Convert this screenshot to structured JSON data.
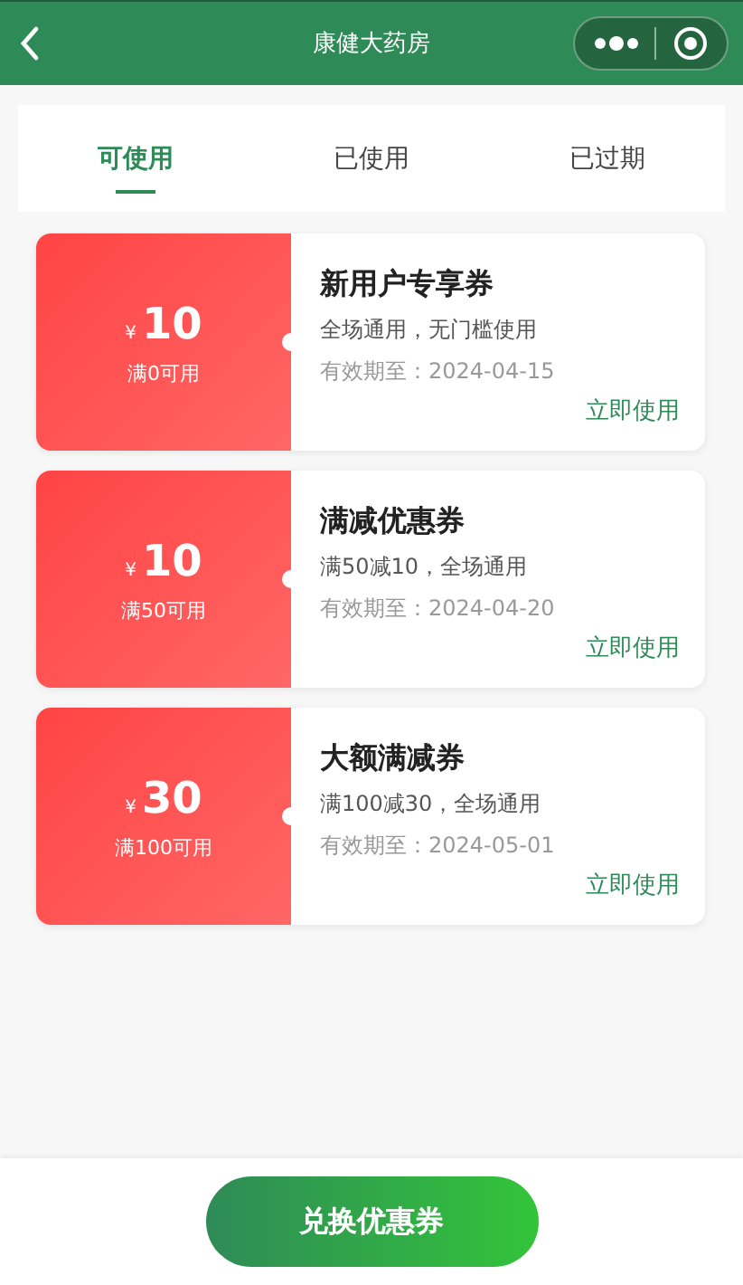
{
  "header": {
    "title": "康健大药房"
  },
  "tabs": [
    {
      "label": "可使用",
      "selected": true
    },
    {
      "label": "已使用",
      "selected": false
    },
    {
      "label": "已过期",
      "selected": false
    }
  ],
  "coupons": [
    {
      "currency": "¥",
      "amount": "10",
      "condition": "满0可用",
      "title": "新用户专享券",
      "description": "全场通用，无门槛使用",
      "expiry": "有效期至：2024-04-15",
      "action": "立即使用"
    },
    {
      "currency": "¥",
      "amount": "10",
      "condition": "满50可用",
      "title": "满减优惠券",
      "description": "满50减10，全场通用",
      "expiry": "有效期至：2024-04-20",
      "action": "立即使用"
    },
    {
      "currency": "¥",
      "amount": "30",
      "condition": "满100可用",
      "title": "大额满减券",
      "description": "满100减30，全场通用",
      "expiry": "有效期至：2024-05-01",
      "action": "立即使用"
    }
  ],
  "footer": {
    "button": "兑换优惠券"
  }
}
